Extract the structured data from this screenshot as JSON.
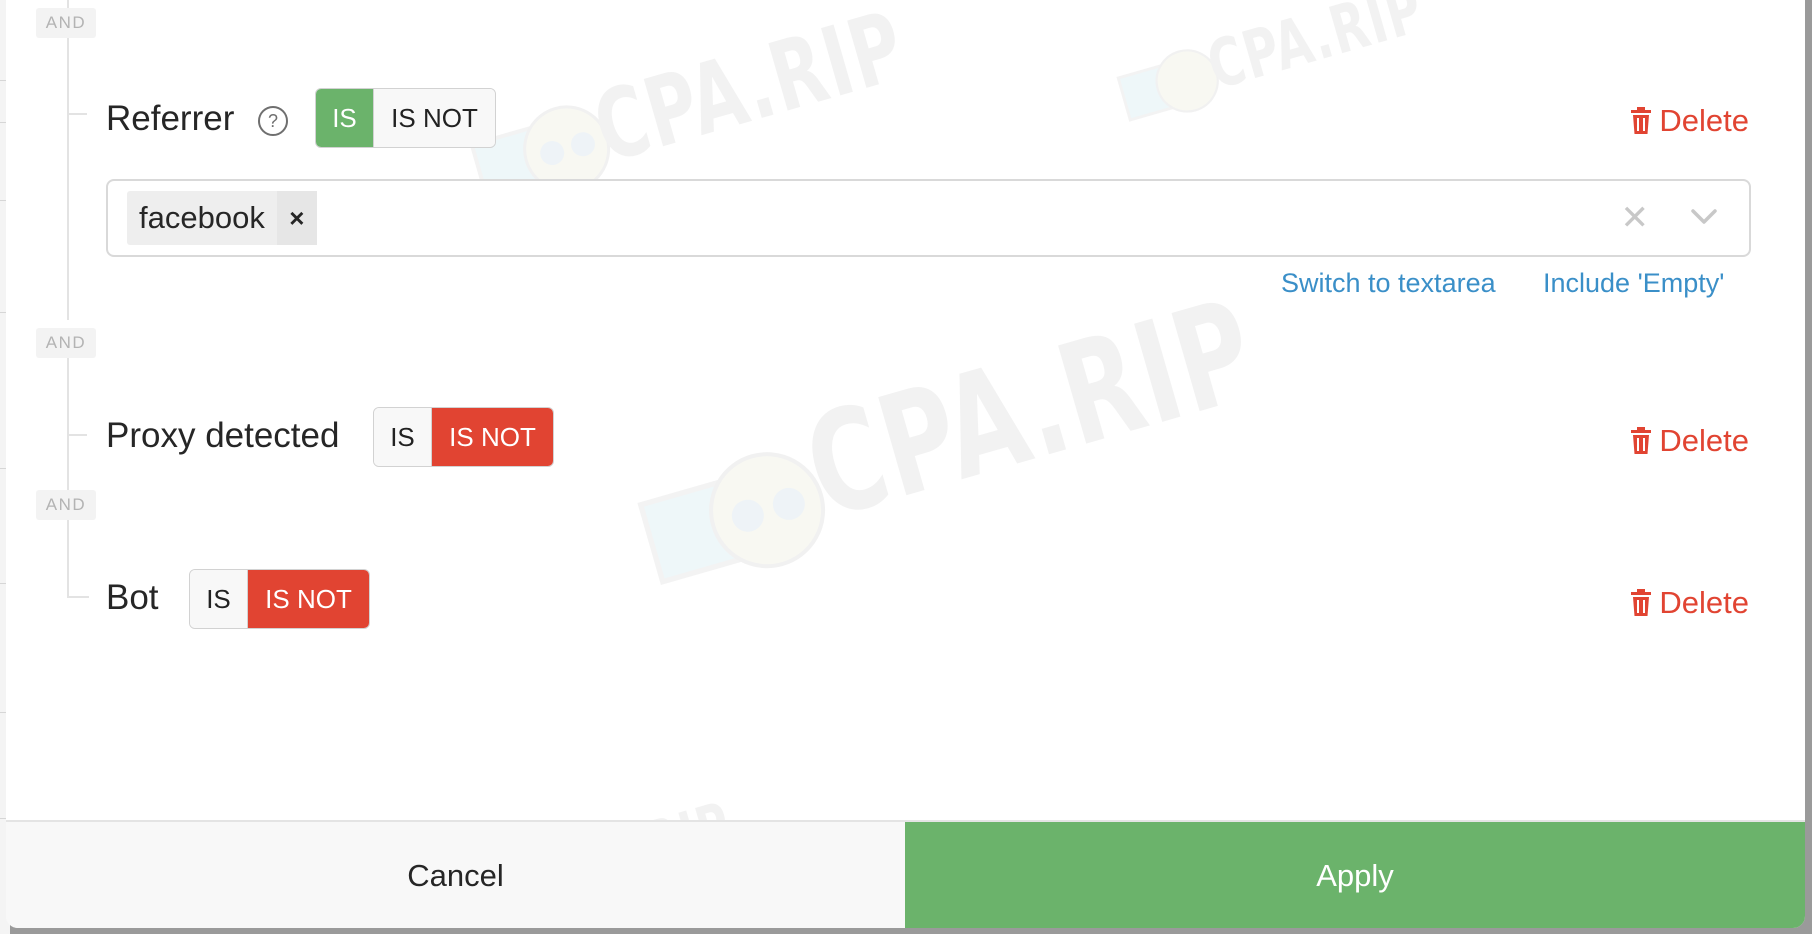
{
  "connector": "AND",
  "conditions": [
    {
      "label": "Referrer",
      "has_help": true,
      "options": [
        "IS",
        "IS NOT"
      ],
      "active": "IS",
      "values": [
        "facebook"
      ],
      "delete_label": "Delete",
      "links": [
        "Switch to textarea",
        "Include 'Empty'"
      ]
    },
    {
      "label": "Proxy detected",
      "options": [
        "IS",
        "IS NOT"
      ],
      "active": "IS NOT",
      "delete_label": "Delete"
    },
    {
      "label": "Bot",
      "options": [
        "IS",
        "IS NOT"
      ],
      "active": "IS NOT",
      "delete_label": "Delete"
    }
  ],
  "help_glyph": "?",
  "chip_remove": "×",
  "clear_glyph": "✕",
  "footer": {
    "cancel": "Cancel",
    "apply": "Apply"
  },
  "watermark": "CPA.RIP",
  "colors": {
    "green": "#6bb36b",
    "red": "#e14432",
    "link": "#3a8fc8"
  },
  "icons": [
    "help-icon",
    "trash-icon",
    "remove-chip-icon",
    "clear-icon",
    "chevron-down-icon"
  ]
}
